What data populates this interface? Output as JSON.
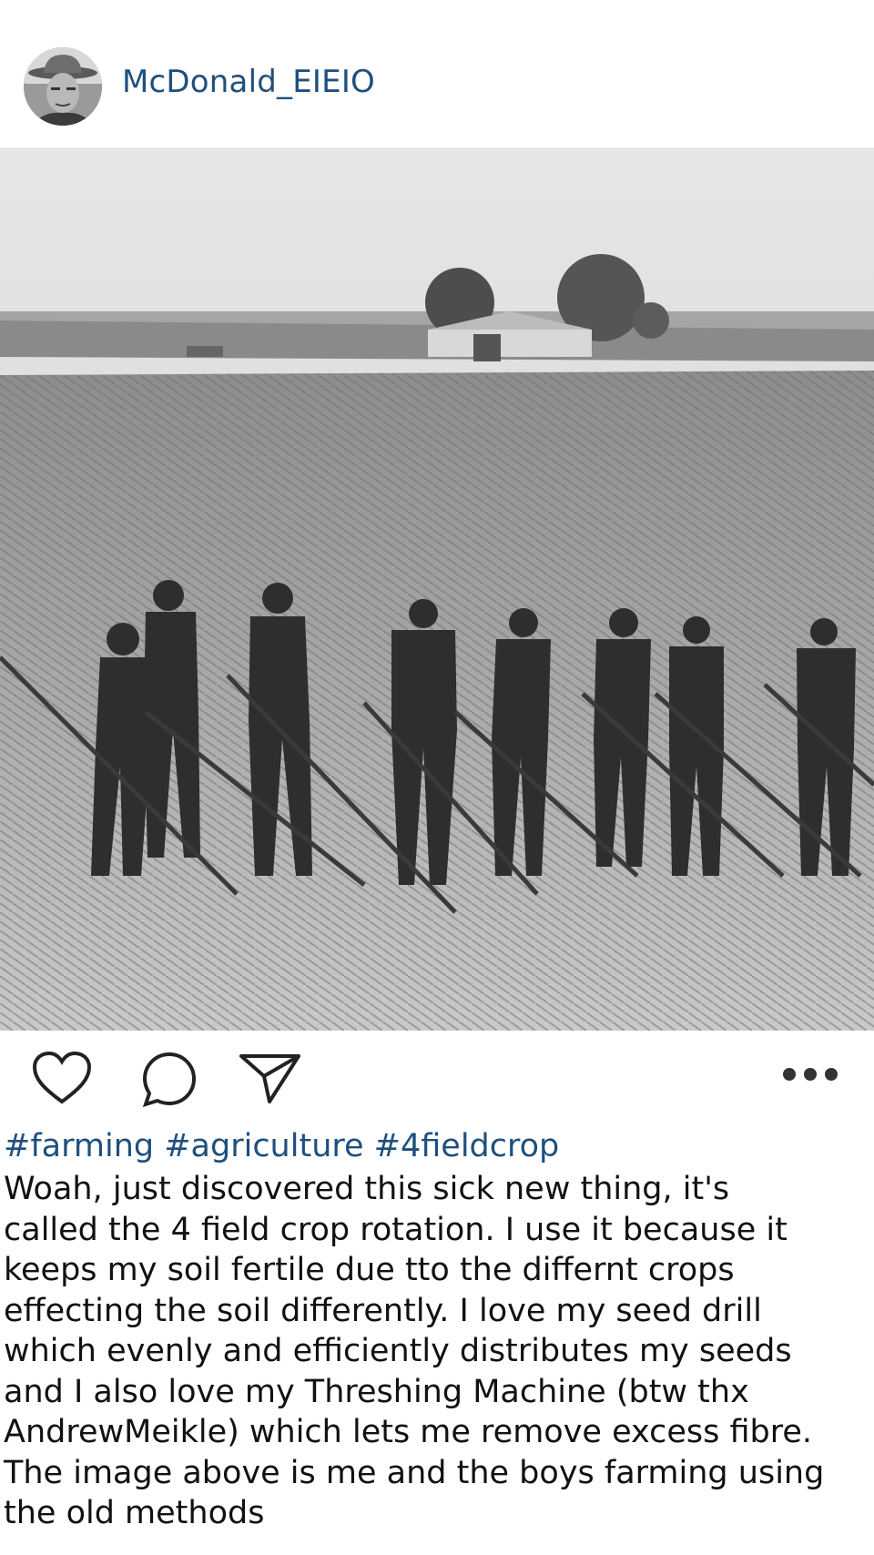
{
  "post": {
    "username": "McDonald_EIEIO",
    "hashtags": "#farming #agriculture #4fieldcrop",
    "caption": "Woah, just discovered this sick new thing, it's\ncalled the 4 field crop rotation. I use it because it\nkeeps my soil fertile due tto the differnt crops\neffecting the soil differently. I love my seed drill\nwhich evenly and efficiently distributes my seeds\nand I also love my Threshing Machine (btw thx\nAndrewMeikle) which lets me remove excess fibre.\nThe image above is me and the boys farming using\nthe old methods"
  },
  "icons": {
    "like": "heart-icon",
    "comment": "comment-icon",
    "share": "send-icon",
    "more": "more-icon"
  },
  "colors": {
    "username": "#1f4f7e",
    "hashtags": "#1f4f7e",
    "text": "#111111"
  }
}
